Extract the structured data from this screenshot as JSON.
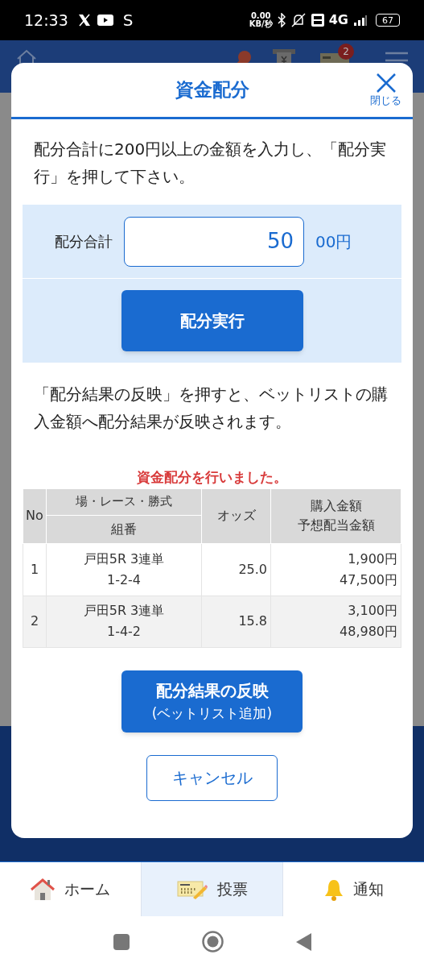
{
  "status_bar": {
    "time": "12:33",
    "notification_letter": "S",
    "net_speed": "0.00",
    "net_unit": "KB/秒",
    "network": "4G",
    "battery": "67"
  },
  "app_header": {
    "badge": "2"
  },
  "dialog": {
    "title": "資金配分",
    "close_label": "閉じる",
    "instruction": "配分合計に200円以上の金額を入力し、「配分実行」を押して下さい。",
    "total_label": "配分合計",
    "total_value": "50",
    "total_suffix": "00円",
    "execute_button": "配分実行",
    "note": "「配分結果の反映」を押すと、ベットリストの購入金額へ配分結果が反映されます。",
    "result_message": "資金配分を行いました。",
    "table": {
      "columns": {
        "no": "No",
        "race_top": "場・レース・勝式",
        "race_bottom": "組番",
        "odds": "オッズ",
        "amount_top": "購入金額",
        "amount_bottom": "予想配当金額"
      },
      "rows": [
        {
          "no": "1",
          "race": "戸田5R 3連単",
          "combo": "1-2-4",
          "odds": "25.0",
          "amount": "1,900円",
          "payout": "47,500円"
        },
        {
          "no": "2",
          "race": "戸田5R 3連単",
          "combo": "1-4-2",
          "odds": "15.8",
          "amount": "3,100円",
          "payout": "48,980円"
        }
      ]
    },
    "apply_button": {
      "label": "配分結果の反映",
      "sub_label": "(ベットリスト追加)"
    },
    "cancel_button": "キャンセル"
  },
  "bottom_nav": [
    {
      "kind": "home",
      "label": "ホーム",
      "selected": false
    },
    {
      "kind": "vote",
      "label": "投票",
      "selected": true
    },
    {
      "kind": "notify",
      "label": "通知",
      "selected": false
    }
  ]
}
